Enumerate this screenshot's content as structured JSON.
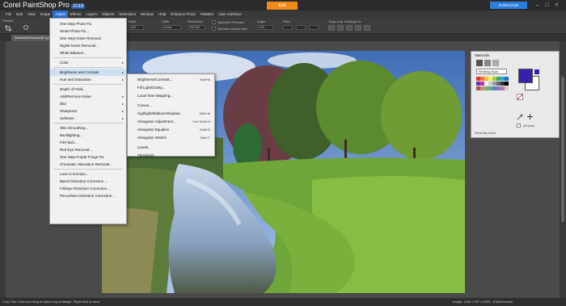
{
  "app": {
    "brand": "Corel PaintShop Pro",
    "version": "2019"
  },
  "titlebar": {
    "edit_tab": "Edit",
    "purchase": "PURCHASE",
    "minimize": "–",
    "maximize": "□",
    "close": "×"
  },
  "menubar": [
    "File",
    "Edit",
    "View",
    "Image",
    "Adjust",
    "Effects",
    "Layers",
    "Objects",
    "Selections",
    "Window",
    "Help",
    "Enhance Photo",
    "Palettes",
    "User Interface"
  ],
  "toolbar": {
    "presets_label": "Presets",
    "width_label": "Width",
    "width_value": "1440",
    "units_label": "Units",
    "units_value": "Inches",
    "resolution_label": "Resolution",
    "resolution_value": "300.000",
    "angle_label": "Angle",
    "angle_value": "0.00",
    "pivot_label": "Pivot",
    "snap_label": "Snap crop rectangle to:",
    "check1": "Specified Printsize",
    "check2": "Maintain aspect ratio"
  },
  "document_tab": "StandardEnhance@1.jpg* @ 44%",
  "adjust_menu": {
    "items": [
      {
        "label": "One Step Photo Fix",
        "arrow": ""
      },
      {
        "label": "Smart Photo Fix...",
        "arrow": ""
      },
      {
        "label": "One Step Noise Removal",
        "arrow": ""
      },
      {
        "label": "Digital Noise Removal...",
        "arrow": ""
      },
      {
        "label": "White Balance...",
        "arrow": ""
      },
      {
        "label": "Color",
        "arrow": "▸"
      },
      {
        "label": "Brightness and Contrast",
        "arrow": "▸"
      },
      {
        "label": "Hue and Saturation",
        "arrow": "▸"
      },
      {
        "label": "Depth of Field...",
        "arrow": ""
      },
      {
        "label": "Add/Remove Noise",
        "arrow": "▸"
      },
      {
        "label": "Blur",
        "arrow": "▸"
      },
      {
        "label": "Sharpness",
        "arrow": "▸"
      },
      {
        "label": "Softness",
        "arrow": "▸"
      },
      {
        "label": "Skin Smoothing...",
        "arrow": ""
      },
      {
        "label": "Backlighting...",
        "arrow": ""
      },
      {
        "label": "Fill Flash...",
        "arrow": ""
      },
      {
        "label": "Red Eye Removal...",
        "arrow": ""
      },
      {
        "label": "One Step Purple Fringe Fix",
        "arrow": ""
      },
      {
        "label": "Chromatic Aberration Removal...",
        "arrow": ""
      },
      {
        "label": "Lens Correction...",
        "arrow": ""
      },
      {
        "label": "Barrel Distortion Correction ...",
        "arrow": ""
      },
      {
        "label": "Fisheye Distortion Correction ...",
        "arrow": ""
      },
      {
        "label": "Pincushion Distortion Correction ...",
        "arrow": ""
      }
    ]
  },
  "brightness_submenu": {
    "items": [
      {
        "label": "Brightness/Contrast...",
        "shortcut": "Shift+B"
      },
      {
        "label": "Fill Light/Clarity...",
        "shortcut": ""
      },
      {
        "label": "Local Tone Mapping...",
        "shortcut": ""
      },
      {
        "label": "Curves...",
        "shortcut": ""
      },
      {
        "label": "Highlight/Midtone/Shadow...",
        "shortcut": "Shift+M"
      },
      {
        "label": "Histogram Adjustment...",
        "shortcut": "Ctrl+Shift+H"
      },
      {
        "label": "Histogram Equalize",
        "shortcut": "Shift+E"
      },
      {
        "label": "Histogram Stretch",
        "shortcut": "Shift+T"
      },
      {
        "label": "Levels...",
        "shortcut": ""
      },
      {
        "label": "Threshold...",
        "shortcut": ""
      }
    ]
  },
  "materials": {
    "title": "Materials",
    "dropdown": "Working Scal",
    "all_tools": "All tools",
    "recently_used": "Recently Used",
    "fg_color": "#3a1fa8",
    "bg_color": "#ffffff"
  },
  "status": {
    "left": "Crop Tool: Click and drag to draw crop rectangle. Right click to clear.",
    "right": "Image: 1440 x 957 x RGB - 8 bits/channel"
  }
}
